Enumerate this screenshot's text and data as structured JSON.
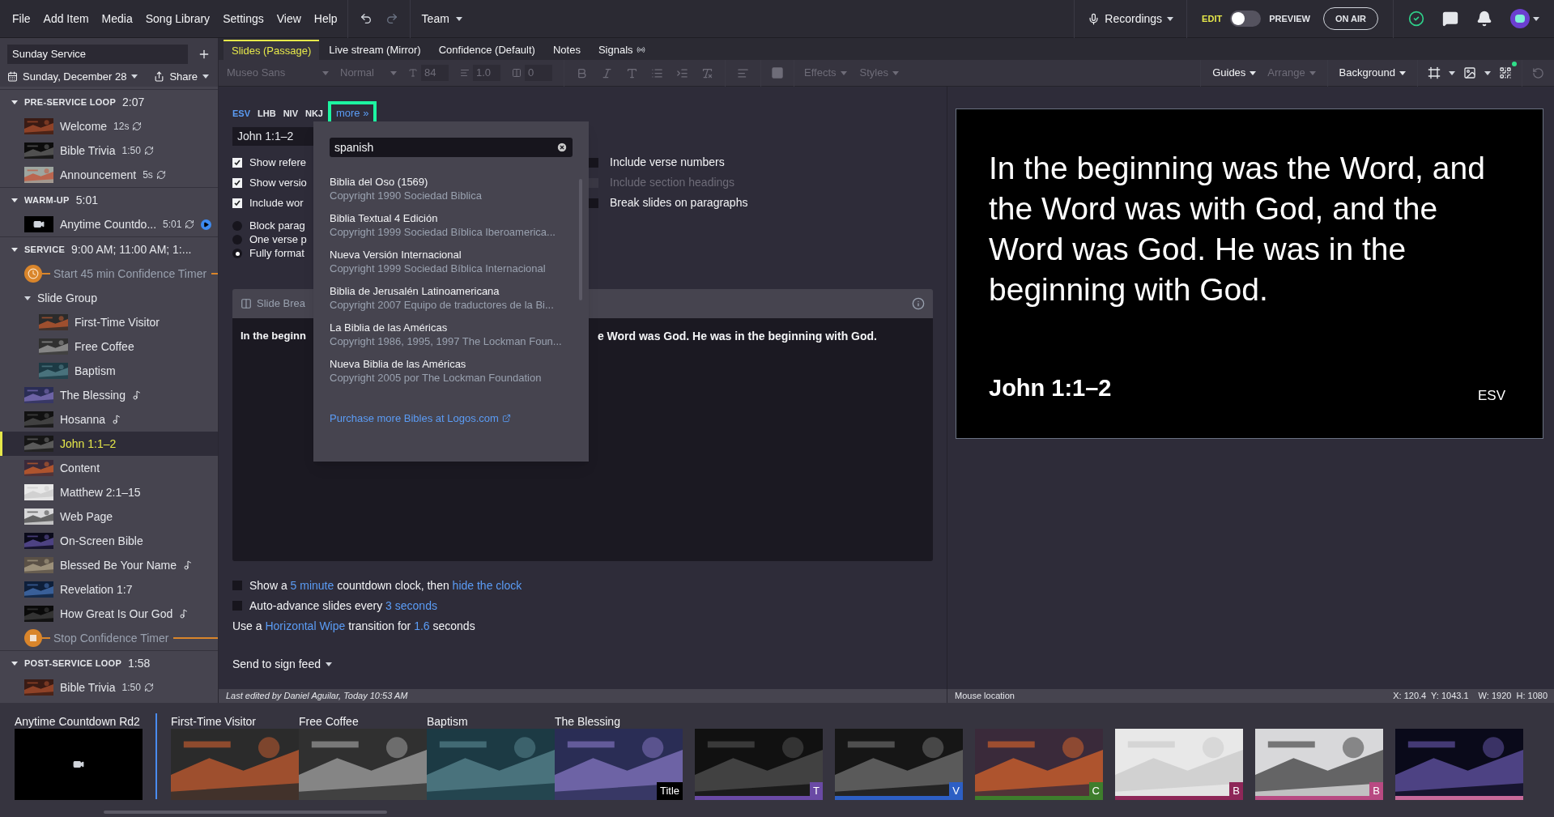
{
  "menu": [
    "File",
    "Add Item",
    "Media",
    "Song Library",
    "Settings",
    "View",
    "Help"
  ],
  "team": {
    "label": "Team"
  },
  "recordings": {
    "label": "Recordings"
  },
  "mode": {
    "edit_label": "EDIT",
    "preview_label": "PREVIEW",
    "on": false
  },
  "on_air": {
    "label": "ON AIR"
  },
  "sidebar": {
    "plan_name": "Sunday Service",
    "date": "Sunday, December 28",
    "share": "Share",
    "sections": [
      {
        "title": "PRE-SERVICE LOOP",
        "duration": "2:07",
        "expanded": true,
        "items": [
          {
            "kind": "item",
            "name": "Welcome",
            "duration": "12s",
            "loop": true,
            "song": false,
            "playing": false,
            "selected": false
          },
          {
            "kind": "item",
            "name": "Bible Trivia",
            "duration": "1:50",
            "loop": true,
            "song": false,
            "playing": false,
            "selected": false
          },
          {
            "kind": "item",
            "name": "Announcement",
            "duration": "5s",
            "loop": true,
            "song": false,
            "playing": false,
            "selected": false
          }
        ]
      },
      {
        "title": "WARM-UP",
        "duration": "5:01",
        "expanded": true,
        "items": [
          {
            "kind": "video",
            "name": "Anytime Countdo...",
            "duration": "5:01",
            "loop": true,
            "song": false,
            "playing": true,
            "selected": false
          }
        ]
      },
      {
        "title": "SERVICE",
        "duration": "9:00 AM; 11:00 AM; 1:...",
        "expanded": true,
        "items": [
          {
            "kind": "timer_start",
            "name": "Start 45 min Confidence Timer"
          },
          {
            "kind": "group",
            "name": "Slide Group",
            "expanded": true,
            "children": [
              {
                "kind": "item",
                "name": "First-Time Visitor",
                "loop": false,
                "song": false,
                "playing": false,
                "selected": false
              },
              {
                "kind": "item",
                "name": "Free Coffee",
                "loop": false,
                "song": false,
                "playing": false,
                "selected": false
              },
              {
                "kind": "item",
                "name": "Baptism",
                "loop": false,
                "song": false,
                "playing": false,
                "selected": false
              }
            ]
          },
          {
            "kind": "item",
            "name": "The Blessing",
            "loop": false,
            "song": true,
            "playing": false,
            "selected": false
          },
          {
            "kind": "item",
            "name": "Hosanna",
            "loop": false,
            "song": true,
            "playing": false,
            "selected": false
          },
          {
            "kind": "item",
            "name": "John 1:1–2",
            "loop": false,
            "song": false,
            "playing": false,
            "selected": true
          },
          {
            "kind": "item",
            "name": "Content",
            "loop": false,
            "song": false,
            "playing": false,
            "selected": false
          },
          {
            "kind": "item",
            "name": "Matthew 2:1–15",
            "loop": false,
            "song": false,
            "playing": false,
            "selected": false
          },
          {
            "kind": "item",
            "name": "Web Page",
            "loop": false,
            "song": false,
            "playing": false,
            "selected": false
          },
          {
            "kind": "item",
            "name": "On-Screen Bible",
            "loop": false,
            "song": false,
            "playing": false,
            "selected": false
          },
          {
            "kind": "item",
            "name": "Blessed Be Your Name",
            "loop": false,
            "song": true,
            "playing": false,
            "selected": false
          },
          {
            "kind": "item",
            "name": "Revelation 1:7",
            "loop": false,
            "song": false,
            "playing": false,
            "selected": false
          },
          {
            "kind": "item",
            "name": "How Great Is Our God",
            "loop": false,
            "song": true,
            "playing": false,
            "selected": false
          },
          {
            "kind": "timer_stop",
            "name": "Stop Confidence Timer"
          }
        ]
      },
      {
        "title": "POST-SERVICE LOOP",
        "duration": "1:58",
        "expanded": true,
        "items": [
          {
            "kind": "item",
            "name": "Bible Trivia",
            "duration": "1:50",
            "loop": true,
            "song": false,
            "playing": false,
            "selected": false
          }
        ]
      }
    ]
  },
  "tabs": [
    {
      "label": "Slides (Passage)",
      "selected": true
    },
    {
      "label": "Live stream (Mirror)",
      "selected": false
    },
    {
      "label": "Confidence (Default)",
      "selected": false
    },
    {
      "label": "Notes",
      "selected": false
    },
    {
      "label": "Signals",
      "selected": false
    }
  ],
  "toolbar": {
    "font": {
      "label": "Museo Sans",
      "disabled": true
    },
    "style": {
      "label": "Normal",
      "disabled": true
    },
    "size": {
      "label": "84",
      "disabled": true
    },
    "line_height": {
      "label": "1.0",
      "disabled": true
    },
    "spacing": {
      "label": "0",
      "disabled": true
    },
    "effects": {
      "label": "Effects",
      "disabled": true
    },
    "styles": {
      "label": "Styles",
      "disabled": true
    },
    "guides": {
      "label": "Guides",
      "disabled": false
    },
    "arrange": {
      "label": "Arrange",
      "disabled": true
    },
    "background": {
      "label": "Background",
      "disabled": false
    }
  },
  "editor": {
    "versions": [
      {
        "label": "ESV",
        "selected": true
      },
      {
        "label": "LHB",
        "selected": false
      },
      {
        "label": "NIV",
        "selected": false
      },
      {
        "label": "NKJ",
        "selected": false
      }
    ],
    "more": {
      "label": "more »"
    },
    "reference": "John 1:1–2",
    "left_options": [
      {
        "label": "Show refere",
        "checked": true
      },
      {
        "label": "Show versio",
        "checked": true
      },
      {
        "label": "Include wor",
        "checked": true
      }
    ],
    "right_options": [
      {
        "label": "Include verse numbers",
        "checked": false,
        "disabled": false
      },
      {
        "label": "Include section headings",
        "checked": false,
        "disabled": true
      },
      {
        "label": "Break slides on paragraphs",
        "checked": false,
        "disabled": false
      }
    ],
    "formats": [
      {
        "label": "Block parag",
        "selected": false
      },
      {
        "label": "One verse p",
        "selected": false
      },
      {
        "label": "Fully format",
        "selected": true
      }
    ],
    "slide_breaks": {
      "title": "Slide Brea",
      "text_start": "In the beginn",
      "text_end": "e Word was God. He was in the beginning with God."
    },
    "options": [
      {
        "kind": "checkbox",
        "checked": false,
        "parts": [
          {
            "text": "Show a ",
            "link": false
          },
          {
            "text": "5 minute",
            "link": true
          },
          {
            "text": " countdown clock, then ",
            "link": false
          },
          {
            "text": "hide the clock",
            "link": true
          }
        ]
      },
      {
        "kind": "checkbox",
        "checked": false,
        "parts": [
          {
            "text": "Auto-advance slides every ",
            "link": false
          },
          {
            "text": "3 seconds",
            "link": true
          }
        ]
      },
      {
        "kind": "text",
        "parts": [
          {
            "text": "Use a ",
            "link": false
          },
          {
            "text": "Horizontal Wipe",
            "link": true
          },
          {
            "text": " transition for ",
            "link": false
          },
          {
            "text": "1.6",
            "link": true
          },
          {
            "text": " seconds",
            "link": false
          }
        ]
      }
    ],
    "sign_feed": "Send to sign feed"
  },
  "popup": {
    "search": "spanish",
    "results": [
      {
        "name": "Biblia del Oso (1569)",
        "copyright": "Copyright 1990 Sociedad Biblica"
      },
      {
        "name": "Biblia Textual 4 Edición",
        "copyright": "Copyright 1999 Sociedad Bíblica Iberoamerica..."
      },
      {
        "name": "Nueva Versión Internacional",
        "copyright": "Copyright 1999 Sociedad Bíblica Internacional"
      },
      {
        "name": "Biblia de Jerusalén Latinoamericana",
        "copyright": "Copyright 2007 Equipo de traductores de la Bi..."
      },
      {
        "name": "La Biblia de las Américas",
        "copyright": "Copyright 1986, 1995, 1997 The Lockman Foun..."
      },
      {
        "name": "Nueva Biblia de las Américas",
        "copyright": "Copyright 2005 por The Lockman Foundation"
      }
    ],
    "purchase": "Purchase more Bibles at Logos.com"
  },
  "preview": {
    "text": "In the beginning was the Word, and the Word was with God, and the Word was God. He was in the beginning with God.",
    "reference": "John 1:1–2",
    "version": "ESV"
  },
  "status": {
    "edited": "Last edited by Daniel Aguilar, Today 10:53 AM",
    "mouse": "Mouse location",
    "coords": "X: 120.4  Y: 1043.1",
    "size": "W: 1920  H: 1080"
  },
  "strip": [
    {
      "title": "Anytime Countdown Rd2",
      "live": true,
      "slides": [
        {
          "kind": "video"
        }
      ]
    },
    {
      "title": "First-Time Visitor",
      "live": false,
      "slides": [
        {
          "kind": "picture"
        }
      ]
    },
    {
      "title": "Free Coffee",
      "live": false,
      "slides": [
        {
          "kind": "picture"
        }
      ]
    },
    {
      "title": "Baptism",
      "live": false,
      "slides": [
        {
          "kind": "picture"
        }
      ]
    },
    {
      "title": "The Blessing",
      "live": false,
      "slides": [
        {
          "kind": "picture",
          "badge": "Title"
        },
        {
          "kind": "picture",
          "badge": "T",
          "color": "#6a4aa5"
        },
        {
          "kind": "picture",
          "badge": "V",
          "color": "#2d5fc4"
        },
        {
          "kind": "picture",
          "badge": "C",
          "color": "#3e7d2c"
        },
        {
          "kind": "picture",
          "badge": "B",
          "color": "#8e2758"
        },
        {
          "kind": "picture",
          "badge": "B",
          "color": "#b84a82"
        },
        {
          "kind": "picture",
          "color": "#c7699a"
        }
      ]
    }
  ]
}
